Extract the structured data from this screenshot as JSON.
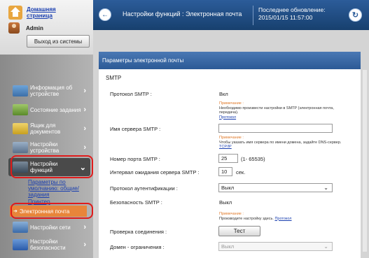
{
  "sidebar": {
    "home_link": "Домашняя страница",
    "user": "Admin",
    "logout": "Выход из системы",
    "items": [
      {
        "label": "Информация об устройстве",
        "icon": "info-device-icon"
      },
      {
        "label": "Состояние задания",
        "icon": "job-status-icon"
      },
      {
        "label": "Ящик для документов",
        "icon": "document-box-icon"
      },
      {
        "label": "Настройки устройства",
        "icon": "device-settings-icon"
      },
      {
        "label": "Настройки функций",
        "icon": "function-settings-icon"
      },
      {
        "label": "Настройки сети",
        "icon": "network-settings-icon"
      },
      {
        "label": "Настройки безопасности",
        "icon": "security-settings-icon"
      }
    ],
    "sub_items": [
      "Параметры по умолчанию: общие/задания",
      "Принтер"
    ],
    "sub_active": "Электронная почта"
  },
  "header": {
    "title": "Настройки функций : Электронная почта",
    "last_update_label": "Последнее обновление:",
    "last_update_time": "2015/01/15 11:57:00"
  },
  "panel": {
    "title": "Параметры электронной почты",
    "section": "SMTP",
    "note_label": "Примечание :",
    "rows": {
      "protocol": {
        "label": "Протокол SMTP :",
        "value": "Вкл"
      },
      "protocol_note": {
        "text": "Необходимо произвести настройки в SMTP (электронная почта, передача).",
        "link": "Протокол"
      },
      "server_name": {
        "label": "Имя сервера SMTP :",
        "value": ""
      },
      "server_note": {
        "text": "Чтобы указать имя сервера по имени домена, задайте DNS-сервер.",
        "link": "TCP/IP"
      },
      "port": {
        "label": "Номер порта SMTP :",
        "value": "25",
        "range": "(1- 65535)"
      },
      "timeout": {
        "label": "Интервал ожидания сервера SMTP :",
        "value": "10",
        "unit": "сек."
      },
      "auth": {
        "label": "Протокол аутентификации :",
        "value": "Выкл"
      },
      "security": {
        "label": "Безопасность SMTP :",
        "value": "Выкл"
      },
      "security_note": {
        "text": "Производите настройку здесь.",
        "link": "Протокол"
      },
      "test": {
        "label": "Проверка соединения :",
        "button": "Тест"
      },
      "domain": {
        "label": "Домен - ограничения :",
        "value": "Выкл"
      }
    }
  },
  "colors": {
    "header": "#2c5c9a",
    "accent": "#e8853a",
    "highlight": "#e01b1b"
  }
}
